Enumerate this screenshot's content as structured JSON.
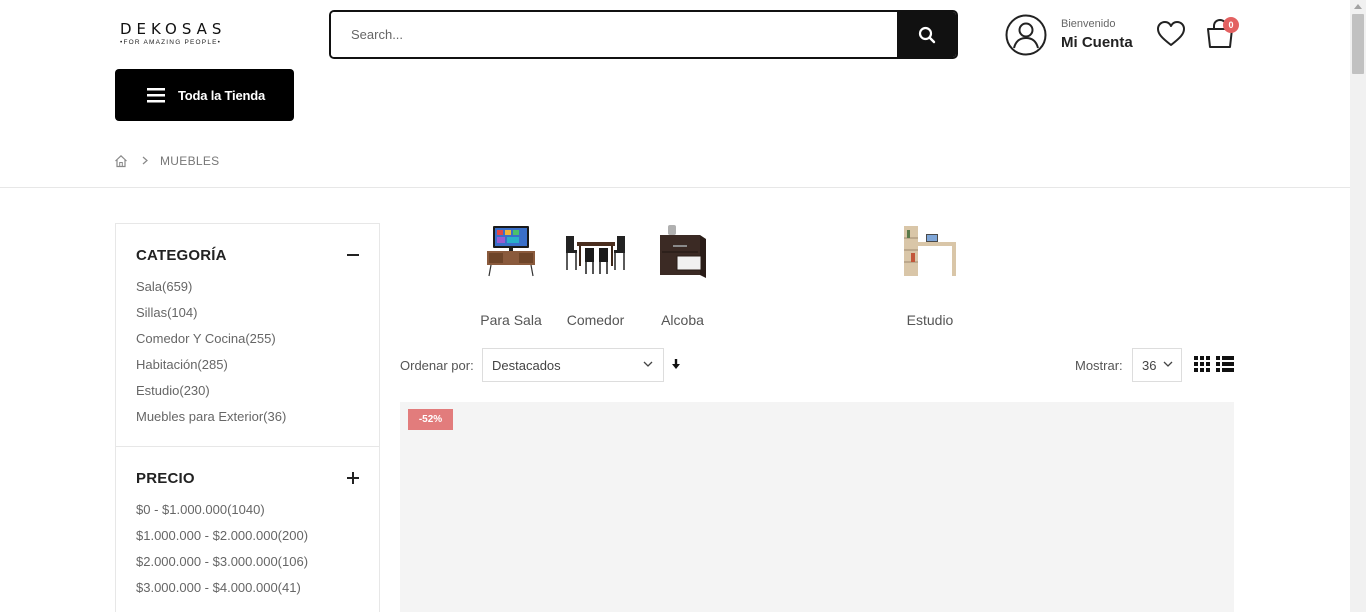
{
  "logo": {
    "name": "DEKOSAS",
    "tagline": "•FOR AMAZING PEOPLE•"
  },
  "search": {
    "placeholder": "Search...",
    "icon": "search-icon"
  },
  "account": {
    "welcome": "Bienvenido",
    "title": "Mi Cuenta",
    "icon": "user-icon"
  },
  "wishlist": {
    "icon": "heart-icon"
  },
  "cart": {
    "icon": "shopping-bag-icon",
    "count": "0"
  },
  "store_button": {
    "label": "Toda la Tienda",
    "icon": "hamburger-icon"
  },
  "breadcrumb": {
    "home_icon": "home-icon",
    "current": "Muebles"
  },
  "sidebar": {
    "category": {
      "title": "CATEGORÍA",
      "items": [
        "Sala(659)",
        "Sillas(104)",
        "Comedor Y Cocina(255)",
        "Habitación(285)",
        "Estudio(230)",
        "Muebles para Exterior(36)"
      ]
    },
    "price": {
      "title": "PRECIO",
      "items": [
        "$0 - $1.000.000(1040)",
        "$1.000.000 - $2.000.000(200)",
        "$2.000.000 - $3.000.000(106)",
        "$3.000.000 - $4.000.000(41)"
      ]
    }
  },
  "categories": [
    {
      "label": "Para Sala",
      "image": "tv-stand-image"
    },
    {
      "label": "Comedor",
      "image": "dining-set-image"
    },
    {
      "label": "Alcoba",
      "image": "nightstand-image"
    },
    {
      "label": "Estudio",
      "image": "desk-image"
    }
  ],
  "toolbar": {
    "sort_label": "Ordenar por:",
    "sort_value": "Destacados",
    "show_label": "Mostrar:",
    "show_value": "36"
  },
  "product": {
    "badge": "-52%"
  },
  "colors": {
    "accent": "#000000",
    "badge": "#e27c7c",
    "cart_count": "#e36161"
  }
}
